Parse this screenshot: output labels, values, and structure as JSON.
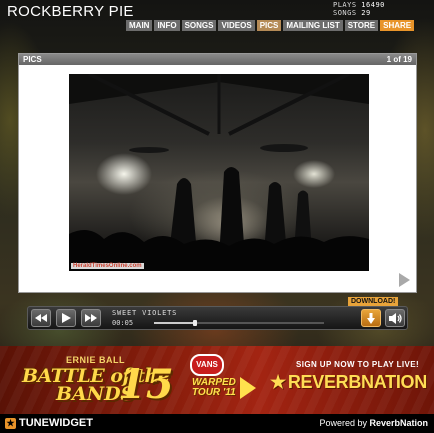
{
  "header": {
    "title": "ROCKBERRY PIE",
    "plays_label": "PLAYS",
    "plays_value": "16490",
    "songs_label": "SONGS",
    "songs_value": "29"
  },
  "nav": {
    "tabs": [
      {
        "label": "MAIN"
      },
      {
        "label": "INFO"
      },
      {
        "label": "SONGS"
      },
      {
        "label": "VIDEOS"
      },
      {
        "label": "PICS",
        "active": true
      },
      {
        "label": "MAILING LIST"
      },
      {
        "label": "STORE"
      },
      {
        "label": "SHARE"
      }
    ]
  },
  "panel": {
    "title": "PICS",
    "counter": "1 of 19",
    "watermark": "HeraldTimesOnline.com",
    "next_icon": "next-arrow-icon"
  },
  "player": {
    "download_label": "DOWNLOAD!",
    "track_title": "SWEET VIOLETS",
    "track_time": "00:05",
    "progress": 0.24,
    "icons": [
      "rewind-icon",
      "play-icon",
      "fast-forward-icon",
      "download-arrow-icon",
      "volume-icon"
    ]
  },
  "banner": {
    "brand": "ERNIE BALL",
    "line1": "BATTLE of the",
    "line2": "BANDS",
    "number": "15",
    "vans": "VANS",
    "warped": "WARPED",
    "warped2": "TOUR '11",
    "signup": "SIGN UP NOW TO PLAY LIVE!",
    "reverb": "REVERBNATION"
  },
  "footer": {
    "widget_label": "TUNEWIDGET",
    "powered_prefix": "Powered by",
    "powered_brand": "ReverbNation"
  },
  "colors": {
    "accent_orange": "#e8942a",
    "tab_gray": "#6c6c6c",
    "tab_active": "#b48a56",
    "banner_red": "#8a1e0c"
  }
}
